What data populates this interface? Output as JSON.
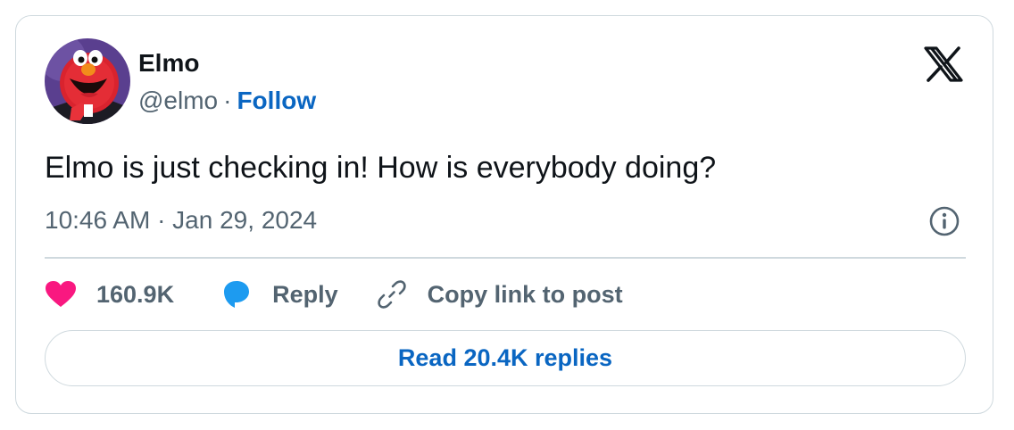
{
  "author": {
    "display_name": "Elmo",
    "handle": "@elmo",
    "separator": "·",
    "follow_label": "Follow",
    "avatar_icon": "elmo-avatar"
  },
  "brand": {
    "logo_icon": "x-logo-icon"
  },
  "tweet": {
    "text": "Elmo is just checking in! How is everybody doing?",
    "timestamp": "10:46 AM · Jan 29, 2024"
  },
  "actions": {
    "like_count": "160.9K",
    "reply_label": "Reply",
    "copy_link_label": "Copy link to post",
    "read_replies_label": "Read 20.4K replies"
  },
  "colors": {
    "link_blue": "#0a66c2",
    "heart_pink": "#f91880",
    "reply_blue": "#1d9bf0",
    "secondary_text": "#536471",
    "border": "#cfd9de"
  }
}
